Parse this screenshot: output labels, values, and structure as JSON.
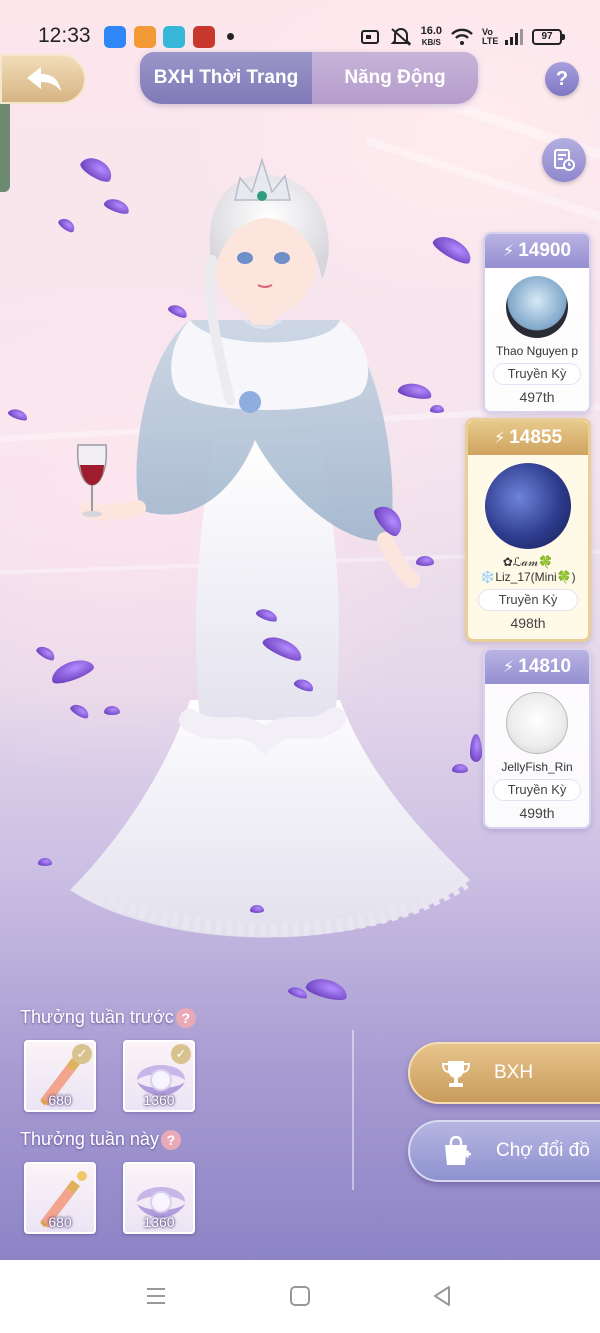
{
  "status_bar": {
    "time": "12:33",
    "net_speed_value": "16.0",
    "net_speed_unit": "KB/S",
    "volte": "Vo LTE",
    "battery": "97"
  },
  "header": {
    "tabs": [
      {
        "label": "BXH Thời Trang",
        "active": true
      },
      {
        "label": "Năng Động",
        "active": false
      }
    ],
    "help_symbol": "?"
  },
  "ranking": [
    {
      "score": "14900",
      "name": "Thao Nguyen p",
      "title": "Truyền Kỳ",
      "rank": "497th",
      "highlight": false
    },
    {
      "score": "14855",
      "name_line1": "✿ℒ𝒶𝓂🍀",
      "name": "❄️Liz_17(Mini🍀)",
      "title": "Truyền Kỳ",
      "rank": "498th",
      "highlight": true
    },
    {
      "score": "14810",
      "name": "JellyFish_Rin",
      "title": "Truyền Kỳ",
      "rank": "499th",
      "highlight": false
    }
  ],
  "rewards": {
    "last_week_label": "Thưởng tuần trước",
    "this_week_label": "Thưởng tuần này",
    "help_symbol": "?",
    "last_week_items": [
      {
        "icon": "perfume-bottle-icon",
        "qty": "680",
        "claimed": true
      },
      {
        "icon": "pearl-shell-icon",
        "qty": "1360",
        "claimed": true
      }
    ],
    "this_week_items": [
      {
        "icon": "perfume-bottle-icon",
        "qty": "680",
        "claimed": false
      },
      {
        "icon": "pearl-shell-icon",
        "qty": "1360",
        "claimed": false
      }
    ]
  },
  "buttons": {
    "leaderboard": "BXH",
    "exchange_shop": "Chợ đổi đồ"
  },
  "colors": {
    "accent_gold": "#d6b483",
    "accent_lavender": "#8f87cc",
    "highlight_border": "#e9cf95"
  }
}
